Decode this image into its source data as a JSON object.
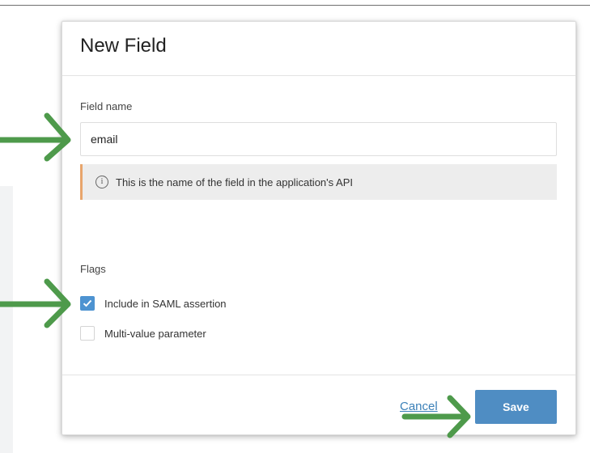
{
  "dialog": {
    "title": "New Field",
    "field_name_label": "Field name",
    "field_name_value": "email",
    "help_icon": "info-icon",
    "help_text": "This is the name of the field in the application's API",
    "flags_label": "Flags",
    "flags": [
      {
        "label": "Include in SAML assertion",
        "checked": true
      },
      {
        "label": "Multi-value parameter",
        "checked": false
      }
    ],
    "cancel_label": "Cancel",
    "save_label": "Save"
  },
  "colors": {
    "accent": "#4f8dc3",
    "checkbox_checked": "#4d93d1",
    "help_border": "#e8a56c",
    "annotation_arrow": "#4e9a4b"
  },
  "annotations": [
    "arrow-icon",
    "arrow-icon",
    "arrow-icon"
  ]
}
